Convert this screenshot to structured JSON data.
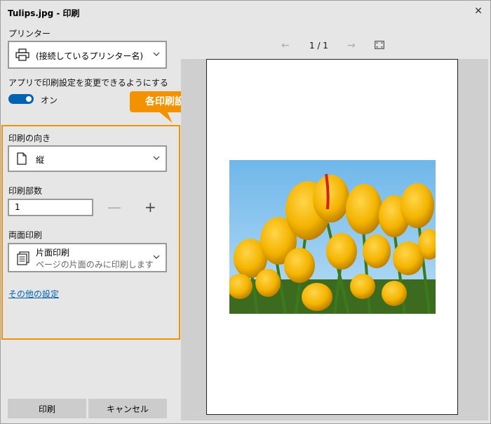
{
  "window": {
    "title": "Tulips.jpg - 印刷"
  },
  "printer": {
    "label": "プリンター",
    "value": "(接続しているプリンター名)"
  },
  "app_settings": {
    "label": "アプリで印刷設定を変更できるようにする",
    "toggle_state": "オン"
  },
  "callout": {
    "text": "各印刷設定を行う"
  },
  "orientation": {
    "label": "印刷の向き",
    "value": "縦"
  },
  "copies": {
    "label": "印刷部数",
    "value": "1",
    "minus": "—",
    "plus": "+"
  },
  "duplex": {
    "label": "両面印刷",
    "value": "片面印刷",
    "description": "ページの片面のみに印刷します"
  },
  "more_settings": {
    "label": "その他の設定"
  },
  "buttons": {
    "print": "印刷",
    "cancel": "キャンセル"
  },
  "preview": {
    "page_indicator": "1 / 1",
    "prev": "←",
    "next": "→"
  },
  "colors": {
    "accent": "#0063b1",
    "highlight": "#f39200"
  }
}
